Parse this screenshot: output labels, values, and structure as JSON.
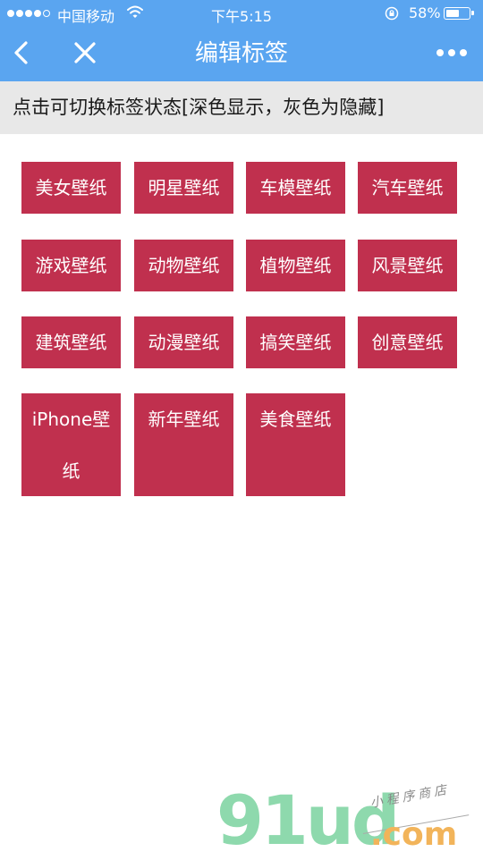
{
  "status_bar": {
    "carrier": "中国移动",
    "time": "下午5:15",
    "battery_percent": "58%",
    "battery_level": 0.58,
    "signal_dots_filled": 4,
    "signal_dots_total": 5
  },
  "nav": {
    "title": "编辑标签",
    "back_icon": "chevron-left-icon",
    "close_icon": "close-icon",
    "more_icon": "more-dots-icon"
  },
  "hint": {
    "text": "点击可切换标签状态[深色显示，灰色为隐藏]"
  },
  "colors": {
    "nav_bg": "#5aa5f0",
    "tag_active": "#c0304e",
    "hint_bg": "#e8e8e8"
  },
  "tags": [
    {
      "label": "美女壁纸",
      "state": "active"
    },
    {
      "label": "明星壁纸",
      "state": "active"
    },
    {
      "label": "车模壁纸",
      "state": "active"
    },
    {
      "label": "汽车壁纸",
      "state": "active"
    },
    {
      "label": "游戏壁纸",
      "state": "active"
    },
    {
      "label": "动物壁纸",
      "state": "active"
    },
    {
      "label": "植物壁纸",
      "state": "active"
    },
    {
      "label": "风景壁纸",
      "state": "active"
    },
    {
      "label": "建筑壁纸",
      "state": "active"
    },
    {
      "label": "动漫壁纸",
      "state": "active"
    },
    {
      "label": "搞笑壁纸",
      "state": "active"
    },
    {
      "label": "创意壁纸",
      "state": "active"
    },
    {
      "label": "iPhone壁纸",
      "state": "active"
    },
    {
      "label": "新年壁纸",
      "state": "active"
    },
    {
      "label": "美食壁纸",
      "state": "active"
    }
  ],
  "watermark": {
    "brand": "91ud",
    "domain_suffix": ".com",
    "tagline": "小程序商店"
  }
}
